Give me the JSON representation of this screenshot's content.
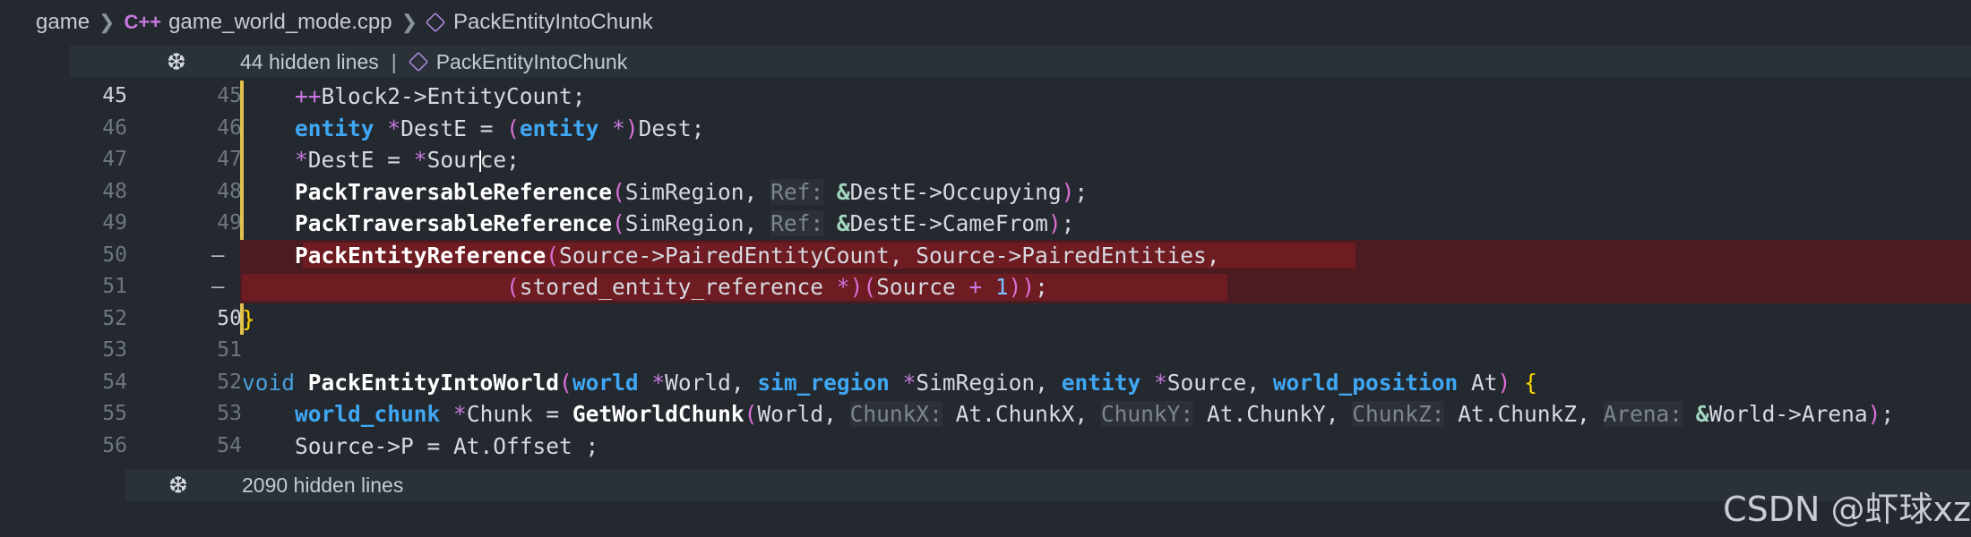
{
  "breadcrumb": {
    "items": [
      "game",
      "game_world_mode.cpp",
      "PackEntityIntoChunk"
    ],
    "cpp_icon": "C++"
  },
  "folds": [
    {
      "label": "44 hidden lines",
      "separator": "|",
      "symbol": "PackEntityIntoChunk"
    },
    {
      "label": "2090 hidden lines",
      "separator": "",
      "symbol": ""
    }
  ],
  "lines": [
    {
      "left": "45",
      "right": "45"
    },
    {
      "left": "46",
      "right": "46"
    },
    {
      "left": "47",
      "right": "47"
    },
    {
      "left": "48",
      "right": "48"
    },
    {
      "left": "49",
      "right": "49"
    },
    {
      "left": "50",
      "right": "—"
    },
    {
      "left": "51",
      "right": "—"
    },
    {
      "left": "52",
      "right": "50"
    },
    {
      "left": "53",
      "right": "51"
    },
    {
      "left": "54",
      "right": "52"
    },
    {
      "left": "55",
      "right": "53"
    },
    {
      "left": "56",
      "right": "54"
    }
  ],
  "code": {
    "l45": {
      "op": "++",
      "rest": "Block2->EntityCount;"
    },
    "l46": {
      "kw1": "entity",
      "op1": "*",
      "mid": "DestE = ",
      "p1": "(",
      "kw2": "entity",
      "op2": "*",
      "p2": ")",
      "end": "Dest;"
    },
    "l47": {
      "op1": "*",
      "a": "DestE = ",
      "op2": "*",
      "b": "Sour",
      "c": "ce;"
    },
    "l48": {
      "fn": "PackTraversableReference",
      "p1": "(",
      "arg": "SimRegion, ",
      "hint": "Ref:",
      "amp": "&",
      "rest": "DestE->Occupying",
      "p2": ")",
      "end": ";"
    },
    "l49": {
      "fn": "PackTraversableReference",
      "p1": "(",
      "arg": "SimRegion, ",
      "hint": "Ref:",
      "amp": "&",
      "rest": "DestE->CameFrom",
      "p2": ")",
      "end": ";"
    },
    "l50": {
      "fn": "PackEntityReference",
      "p1": "(",
      "rest": "Source->PairedEntityCount, Source->PairedEntities,"
    },
    "l51": {
      "p1": "(",
      "a": "stored_entity_reference ",
      "op": "*",
      "p2": ")",
      "p3": "(",
      "b": "Source ",
      "plus": "+",
      "num": "1",
      "p4": "))",
      "end": ";"
    },
    "l52": {
      "brace": "}"
    },
    "l54": {
      "kw": "void",
      "fn": "PackEntityIntoWorld",
      "p1": "(",
      "t1": "world",
      "s1": "*",
      "a1": "World, ",
      "t2": "sim_region",
      "s2": "*",
      "a2": "SimRegion, ",
      "t3": "entity",
      "s3": "*",
      "a3": "Source, ",
      "t4": "world_position",
      "a4": " At",
      "p2": ")",
      "brace": "{"
    },
    "l55": {
      "t": "world_chunk",
      "s": "*",
      "a": "Chunk = ",
      "fn": "GetWorldChunk",
      "p1": "(",
      "w": "World, ",
      "h1": "ChunkX:",
      "v1": "At.ChunkX, ",
      "h2": "ChunkY:",
      "v2": "At.ChunkY, ",
      "h3": "ChunkZ:",
      "v3": "At.ChunkZ, ",
      "h4": "Arena:",
      "amp": "&",
      "v4": "World->Arena",
      "p2": ")",
      "end": ";"
    },
    "l56": {
      "text": "Source->P = At.Offset_;"
    }
  },
  "watermark": "CSDN @虾球xz",
  "colors": {
    "removed_line": "#4a1c22",
    "removed_text": "#6e1b22",
    "modified_gutter": "#e2c24c"
  }
}
